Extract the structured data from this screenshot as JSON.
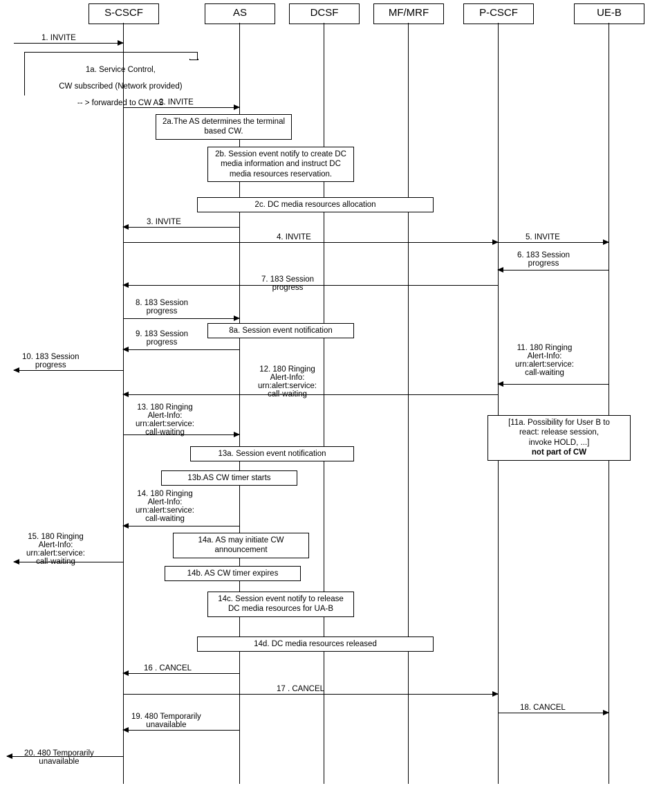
{
  "participants": {
    "scscf": "S-CSCF",
    "as": "AS",
    "dcsf": "DCSF",
    "mfmrf": "MF/MRF",
    "pcscf": "P-CSCF",
    "ueb": "UE-B"
  },
  "chart_data": {
    "type": "sequence",
    "participants": [
      "S-CSCF",
      "AS",
      "DCSF",
      "MF/MRF",
      "P-CSCF",
      "UE-B"
    ],
    "messages": [
      {
        "id": "1",
        "from": "ext-left",
        "to": "S-CSCF",
        "text": "1. INVITE"
      },
      {
        "id": "1a",
        "at": "S-CSCF",
        "type": "fragment",
        "text": "1a. Service Control,\nCW subscribed (Network provided)\n-- > forwarded to CW AS"
      },
      {
        "id": "2",
        "from": "S-CSCF",
        "to": "AS",
        "text": "2. INVITE"
      },
      {
        "id": "2a",
        "at": "AS",
        "type": "note",
        "text": "2a.The AS determines the\nterminal based CW."
      },
      {
        "id": "2b",
        "at": "AS/DCSF",
        "type": "note",
        "text": "2b. Session event notify to\ncreate DC media information\nand instruct DC media\nresources reservation."
      },
      {
        "id": "2c",
        "at": "AS/DCSF/MF-MRF",
        "type": "note",
        "text": "2c. DC media resources allocation"
      },
      {
        "id": "3",
        "from": "AS",
        "to": "S-CSCF",
        "text": "3. INVITE"
      },
      {
        "id": "4",
        "from": "S-CSCF",
        "to": "P-CSCF",
        "text": "4. INVITE"
      },
      {
        "id": "5",
        "from": "P-CSCF",
        "to": "UE-B",
        "text": "5. INVITE"
      },
      {
        "id": "6",
        "from": "UE-B",
        "to": "P-CSCF",
        "text": "6. 183 Session\nprogress"
      },
      {
        "id": "7",
        "from": "P-CSCF",
        "to": "S-CSCF",
        "text": "7. 183 Session\nprogress"
      },
      {
        "id": "8",
        "from": "S-CSCF",
        "to": "AS",
        "text": "8. 183 Session\nprogress"
      },
      {
        "id": "8a",
        "at": "AS/DCSF",
        "type": "note",
        "text": "8a. Session event notification"
      },
      {
        "id": "9",
        "from": "AS",
        "to": "S-CSCF",
        "text": "9. 183 Session\nprogress"
      },
      {
        "id": "10",
        "from": "S-CSCF",
        "to": "ext-left",
        "text": "10. 183 Session\nprogress"
      },
      {
        "id": "11",
        "from": "UE-B",
        "to": "P-CSCF",
        "text": "11. 180 Ringing\nAlert-Info:\nurn:alert:service:\ncall-waiting"
      },
      {
        "id": "11a",
        "at": "P-CSCF/UE-B",
        "type": "note",
        "text": "[11a. Possibility for User B to\nreact: release session,\ninvoke HOLD, ...]\nnot part of CW"
      },
      {
        "id": "12",
        "from": "P-CSCF",
        "to": "S-CSCF",
        "text": "12. 180 Ringing\nAlert-Info:\nurn:alert:service:\ncall-waiting"
      },
      {
        "id": "13",
        "from": "S-CSCF",
        "to": "AS",
        "text": "13. 180 Ringing\nAlert-Info:\nurn:alert:service:\ncall-waiting"
      },
      {
        "id": "13a",
        "at": "AS/DCSF",
        "type": "note",
        "text": "13a. Session event notification"
      },
      {
        "id": "13b",
        "at": "AS",
        "type": "note",
        "text": "13b.AS CW timer starts"
      },
      {
        "id": "14",
        "from": "AS",
        "to": "S-CSCF",
        "text": "14. 180 Ringing\nAlert-Info:\nurn:alert:service:\ncall-waiting"
      },
      {
        "id": "14a",
        "at": "AS",
        "type": "note",
        "text": "14a. AS may initiate CW\nannouncement"
      },
      {
        "id": "14b",
        "at": "AS",
        "type": "note",
        "text": "14b. AS CW timer expires"
      },
      {
        "id": "14c",
        "at": "AS/DCSF",
        "type": "note",
        "text": "14c. Session event notify to\nrelease DC media resources\nfor UA-B"
      },
      {
        "id": "14d",
        "at": "AS/DCSF/MF-MRF",
        "type": "note",
        "text": "14d. DC media resources released"
      },
      {
        "id": "15",
        "from": "S-CSCF",
        "to": "ext-left",
        "text": "15. 180 Ringing\nAlert-Info:\nurn:alert:service:\ncall-waiting"
      },
      {
        "id": "16",
        "from": "AS",
        "to": "S-CSCF",
        "text": "16 . CANCEL"
      },
      {
        "id": "17",
        "from": "S-CSCF",
        "to": "P-CSCF",
        "text": "17 . CANCEL"
      },
      {
        "id": "18",
        "from": "P-CSCF",
        "to": "UE-B",
        "text": "18. CANCEL"
      },
      {
        "id": "19",
        "from": "AS",
        "to": "S-CSCF",
        "text": "19. 480 Temporarily\nunavailable"
      },
      {
        "id": "20",
        "from": "S-CSCF",
        "to": "ext-left",
        "text": "20. 480 Temporarily\nunavailable"
      }
    ]
  },
  "labels": {
    "m1": "1. INVITE",
    "n1a_l1": "1a. Service Control,",
    "n1a_l2": "CW subscribed (Network provided)",
    "n1a_l3": "-- > forwarded to CW AS",
    "m2": "2. INVITE",
    "n2a": "2a.The AS determines the\nterminal based CW.",
    "n2b": "2b. Session event  notify to\ncreate DC media information\nand instruct DC media\nresources reservation.",
    "n2c": "2c. DC media resources allocation",
    "m3": "3. INVITE",
    "m4": "4. INVITE",
    "m5": "5. INVITE",
    "m6": "6. 183 Session\nprogress",
    "m7": "7. 183 Session\nprogress",
    "m8": "8. 183 Session\nprogress",
    "n8a": "8a. Session event notification",
    "m9": "9. 183 Session\nprogress",
    "m10": "10. 183 Session\nprogress",
    "m11": "11. 180 Ringing\nAlert-Info:\nurn:alert:service:\ncall-waiting",
    "n11a_l1": "[11a. Possibility for User B to",
    "n11a_l2": "react: release session,",
    "n11a_l3": "invoke HOLD, ...]",
    "n11a_l4": "not part of CW",
    "m12": "12. 180 Ringing\nAlert-Info:\nurn:alert:service:\ncall-waiting",
    "m13": "13. 180 Ringing\nAlert-Info:\nurn:alert:service:\ncall-waiting",
    "n13a": "13a. Session event notification",
    "n13b": "13b.AS CW timer starts",
    "m14": "14. 180 Ringing\nAlert-Info:\nurn:alert:service:\ncall-waiting",
    "n14a": "14a. AS may initiate CW\nannouncement",
    "n14b": "14b. AS  CW timer expires",
    "n14c": "14c. Session event  notify to\nrelease DC media resources\nfor UA-B",
    "n14d": "14d. DC media resources released",
    "m15": "15. 180 Ringing\nAlert-Info:\nurn:alert:service:\ncall-waiting",
    "m16": "16 . CANCEL",
    "m17": "17 . CANCEL",
    "m18": "18. CANCEL",
    "m19": "19. 480 Temporarily\nunavailable",
    "m20": "20. 480 Temporarily\nunavailable"
  }
}
